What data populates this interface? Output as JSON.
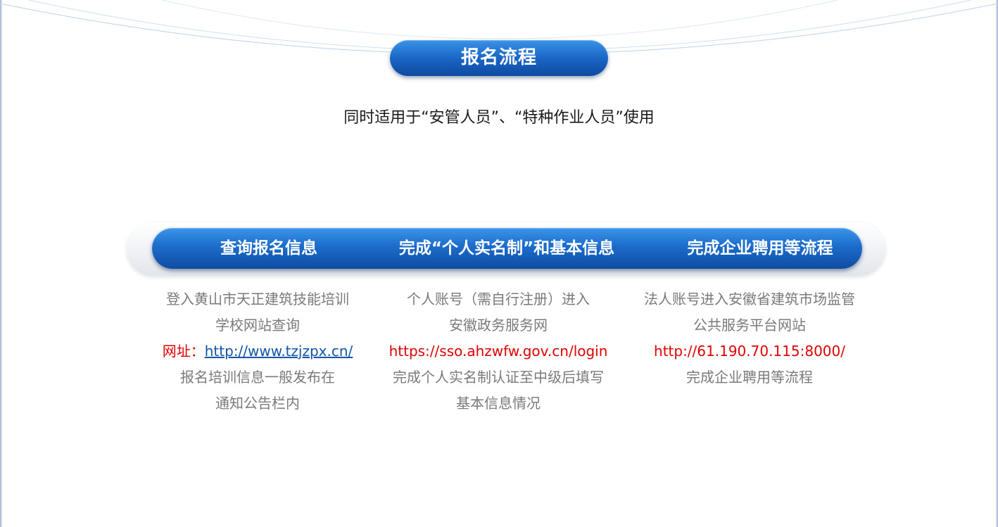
{
  "header": {
    "title": "报名流程",
    "subtitle": "同时适用于“安管人员”、“特种作业人员”使用"
  },
  "steps": [
    {
      "title": "查询报名信息",
      "lines": [
        "登入黄山市天正建筑技能培训",
        "学校网站查询"
      ],
      "url_prefix": "网址：",
      "url": "http://www.tzjzpx.cn/",
      "after": [
        "报名培训信息一般发布在",
        "通知公告栏内"
      ]
    },
    {
      "title": "完成“个人实名制”和基本信息",
      "lines": [
        "个人账号（需自行注册）进入",
        "安徽政务服务网"
      ],
      "url": "https://sso.ahzwfw.gov.cn/login",
      "after": [
        "完成个人实名制认证至中级后填写",
        "基本信息情况"
      ]
    },
    {
      "title": "完成企业聘用等流程",
      "lines": [
        "法人账号进入安徽省建筑市场监管",
        "公共服务平台网站"
      ],
      "url": "http://61.190.70.115:8000/",
      "after": [
        "完成企业聘用等流程"
      ]
    }
  ],
  "colors": {
    "accent_blue": "#1a66c6",
    "url_red": "#e00000",
    "link_blue": "#1155aa",
    "body_gray": "#7a7a7a"
  }
}
